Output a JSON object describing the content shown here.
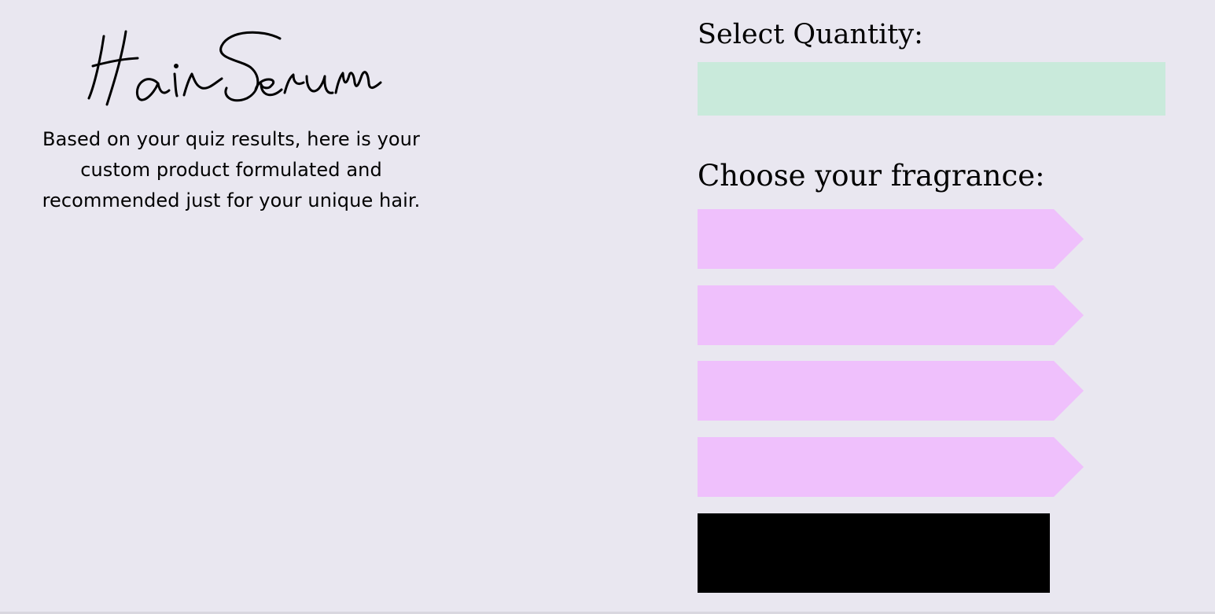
{
  "product": {
    "title": "Hair Serum",
    "description": "Based on your quiz results, here is your custom product formulated and recommended just for your unique hair."
  },
  "quantity": {
    "label": "Select Quantity:",
    "value": ""
  },
  "fragrance": {
    "label": "Choose your fragrance:",
    "options": [
      {
        "label": ""
      },
      {
        "label": ""
      },
      {
        "label": ""
      },
      {
        "label": ""
      }
    ]
  },
  "submit": {
    "label": ""
  },
  "colors": {
    "background": "#e9e7f0",
    "quantity_box": "#c9eadb",
    "fragrance_option": "#efc0fc",
    "submit_button": "#000000",
    "text": "#000000"
  }
}
